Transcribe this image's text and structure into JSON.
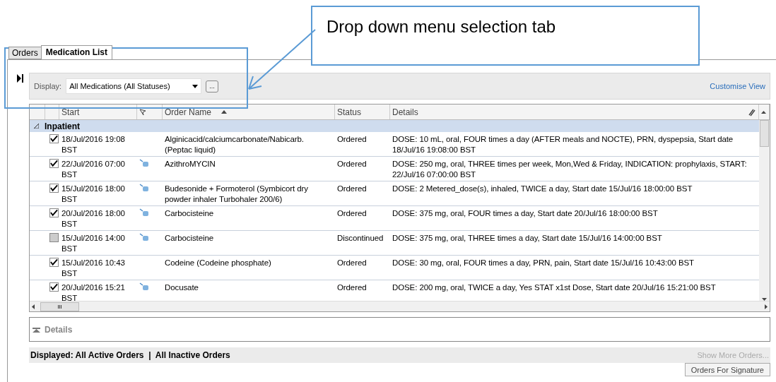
{
  "tabs": [
    {
      "label": "Orders",
      "selected": false
    },
    {
      "label": "Medication List",
      "selected": true
    }
  ],
  "toolbar": {
    "display_label": "Display:",
    "display_value": "All Medications (All Statuses)",
    "more_button": "...",
    "customise_link": "Customise View"
  },
  "table": {
    "columns": [
      {
        "kind": "blank"
      },
      {
        "kind": "blank"
      },
      {
        "kind": "text",
        "label": "Start"
      },
      {
        "kind": "flag"
      },
      {
        "kind": "sorted",
        "label": "Order Name"
      },
      {
        "kind": "text",
        "label": "Status"
      },
      {
        "kind": "details",
        "label": "Details"
      }
    ],
    "group": {
      "label": "Inpatient",
      "expanded": true
    },
    "rows": [
      {
        "checked": true,
        "start": "18/Jul/2016 19:08 BST",
        "pharmacy_icon": false,
        "order_name": "Alginicacid/calciumcarbonate/Nabicarb. (Peptac liquid)",
        "status": "Ordered",
        "details": "DOSE: 10 mL, oral, FOUR times a day (AFTER meals and NOCTE), PRN, dyspepsia, Start date 18/Jul/16 19:08:00 BST"
      },
      {
        "checked": true,
        "start": "22/Jul/2016 07:00 BST",
        "pharmacy_icon": true,
        "order_name": "AzithroMYCIN",
        "status": "Ordered",
        "details": "DOSE: 250 mg, oral, THREE times per week, Mon,Wed & Friday, INDICATION: prophylaxis, START: 22/Jul/16 07:00:00 BST"
      },
      {
        "checked": true,
        "start": "15/Jul/2016 18:00 BST",
        "pharmacy_icon": true,
        "order_name": "Budesonide + Formoterol (Symbicort dry powder inhaler Turbohaler 200/6)",
        "status": "Ordered",
        "details": "DOSE: 2 Metered_dose(s), inhaled, TWICE a day, Start date 15/Jul/16 18:00:00 BST"
      },
      {
        "checked": true,
        "start": "20/Jul/2016 18:00 BST",
        "pharmacy_icon": true,
        "order_name": "Carbocisteine",
        "status": "Ordered",
        "details": "DOSE: 375 mg, oral, FOUR times a day, Start date 20/Jul/16 18:00:00 BST"
      },
      {
        "checked": false,
        "start": "15/Jul/2016 14:00 BST",
        "pharmacy_icon": true,
        "order_name": "Carbocisteine",
        "status": "Discontinued",
        "details": "DOSE: 375 mg, oral, THREE times a day, Start date 15/Jul/16 14:00:00 BST"
      },
      {
        "checked": true,
        "start": "15/Jul/2016 10:43 BST",
        "pharmacy_icon": false,
        "order_name": "Codeine (Codeine phosphate)",
        "status": "Ordered",
        "details": "DOSE: 30 mg, oral, FOUR times a day, PRN, pain, Start date 15/Jul/16 10:43:00 BST"
      },
      {
        "checked": true,
        "start": "20/Jul/2016 15:21 BST",
        "pharmacy_icon": true,
        "order_name": "Docusate",
        "status": "Ordered",
        "details": "DOSE: 200 mg, oral, TWICE a day, Yes STAT x1st Dose, Start date 20/Jul/16 15:21:00 BST"
      }
    ],
    "scrollbar_grip": "III"
  },
  "details_panel": {
    "label": "Details",
    "expanded": false
  },
  "footer": {
    "displayed": "Displayed: All Active Orders  |  All Inactive Orders",
    "show_more": {
      "label": "Show More Orders...",
      "disabled": true
    },
    "signature_button": "Orders For Signature"
  },
  "annotation": {
    "callout": "Drop down menu selection tab"
  }
}
